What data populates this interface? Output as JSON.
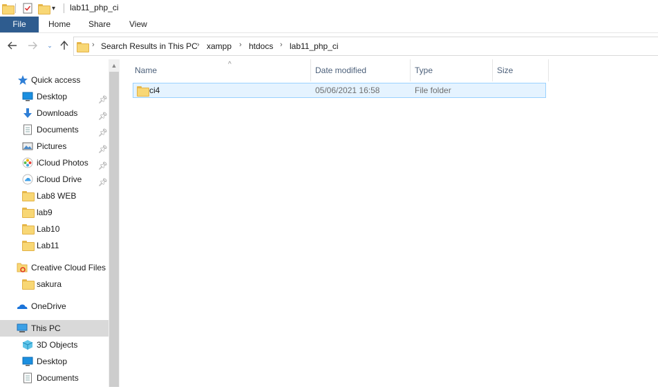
{
  "window": {
    "title": "lab11_php_ci"
  },
  "ribbon": {
    "tabs": [
      "File",
      "Home",
      "Share",
      "View"
    ]
  },
  "address": {
    "crumbs": [
      "Search Results in This PC",
      "xampp",
      "htdocs",
      "lab11_php_ci"
    ]
  },
  "nav": {
    "items": [
      {
        "label": "Quick access",
        "icon": "star-icon",
        "pinned": false
      },
      {
        "label": "Desktop",
        "icon": "desktop-icon",
        "pinned": true
      },
      {
        "label": "Downloads",
        "icon": "download-arrow-icon",
        "pinned": true
      },
      {
        "label": "Documents",
        "icon": "document-icon",
        "pinned": true
      },
      {
        "label": "Pictures",
        "icon": "pictures-icon",
        "pinned": true
      },
      {
        "label": "iCloud Photos",
        "icon": "icloud-photos-icon",
        "pinned": true
      },
      {
        "label": "iCloud Drive",
        "icon": "icloud-drive-icon",
        "pinned": true
      },
      {
        "label": "Lab8 WEB",
        "icon": "folder-icon",
        "pinned": false
      },
      {
        "label": "lab9",
        "icon": "folder-icon",
        "pinned": false
      },
      {
        "label": "Lab10",
        "icon": "folder-icon",
        "pinned": false
      },
      {
        "label": "Lab11",
        "icon": "folder-icon",
        "pinned": false
      },
      {
        "label": "Creative Cloud Files",
        "icon": "creative-cloud-icon",
        "pinned": false
      },
      {
        "label": "sakura",
        "icon": "folder-icon",
        "pinned": false
      },
      {
        "label": "OneDrive",
        "icon": "onedrive-icon",
        "pinned": false
      },
      {
        "label": "This PC",
        "icon": "this-pc-icon",
        "pinned": false,
        "selected": true
      },
      {
        "label": "3D Objects",
        "icon": "3d-objects-icon",
        "pinned": false
      },
      {
        "label": "Desktop",
        "icon": "desktop-icon",
        "pinned": false
      },
      {
        "label": "Documents",
        "icon": "document-icon",
        "pinned": false
      }
    ]
  },
  "columns": {
    "name": "Name",
    "date": "Date modified",
    "type": "Type",
    "size": "Size"
  },
  "files": [
    {
      "name": "ci4",
      "date": "05/06/2021 16:58",
      "type": "File folder",
      "size": ""
    }
  ],
  "colors": {
    "file_tab": "#2e5c8f",
    "selection_bg": "#e5f3ff",
    "selection_border": "#99d1ff",
    "header_text": "#4c607a"
  }
}
